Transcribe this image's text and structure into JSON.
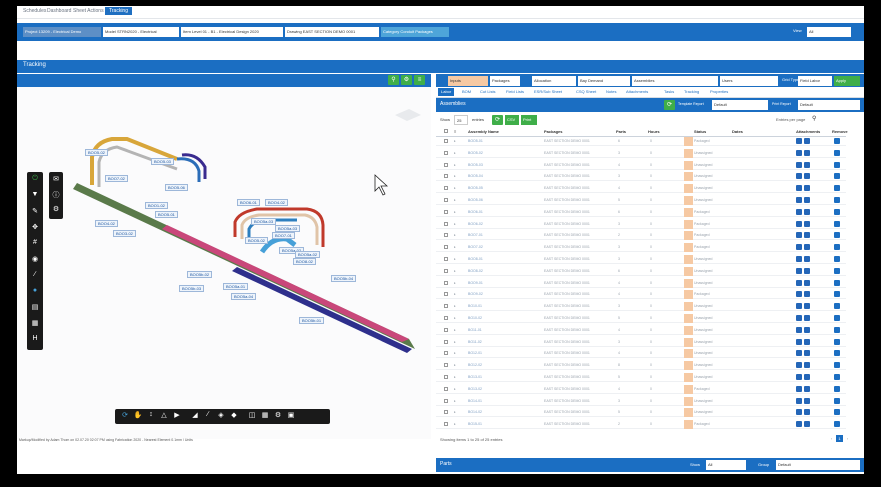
{
  "top_nav": {
    "items": [
      "Schedules",
      "Dashboard",
      "Sheet Actions",
      "Tracking"
    ],
    "active": "Tracking"
  },
  "filters": {
    "project": "Project  13209 - Electrical Demo",
    "model": "Model  STRN2020 - Electrical",
    "item": "Item  Level 01 - B1 - Electrical Design 2020",
    "drawing": "Drawing  EAST SECTION DEMO 0001",
    "category": "Category  Conduit Packages",
    "view_label": "View",
    "view_value": "All"
  },
  "tracking": {
    "title": "Tracking"
  },
  "tags": [
    "BOO5-02",
    "BOO5-03",
    "BOO7-02",
    "BOO5-06",
    "BOO1-02",
    "BOO5-01",
    "BOO4-02",
    "BOO3-02",
    "BOO6-01",
    "BOO4-02",
    "BOO7-01",
    "BOO5-02",
    "BOO5a-02",
    "BOO5a-03",
    "BOO5a-02",
    "BOO5a-03",
    "BOO8-02",
    "BOO5b-02",
    "BOO5b-03",
    "BOO5a-01",
    "BOO5a-04",
    "BOO5b-01",
    "BOO5b-04"
  ],
  "status_line": "Markup/Modified by Adam Thom on 02.07.20 02:07 PM using Fabrication 2020 - Nearest Element 0.1mm / Units",
  "right_header": {
    "label1": "Inputs",
    "sel1": "Packages",
    "sel2": "Allocation",
    "sel3": "Bay Demand",
    "sel4": "Assemblies",
    "sel5": "Users",
    "grid_type_label": "Grid Type",
    "grid_type": "Field Labor",
    "apply": "Apply"
  },
  "tabs": [
    "Labor",
    "BOM",
    "Cut Lists",
    "Field Lists",
    "ESR/Sub Sheet",
    "CSQ Sheet",
    "Notes",
    "Attachments",
    "Tasks",
    "Tracking",
    "Properties"
  ],
  "assemblies": {
    "title": "Assemblies",
    "template_label": "Template Report",
    "template_value": "Default",
    "filter_label": "Print Report",
    "filter_value": "Default",
    "show_label": "Show",
    "show_value": "25",
    "entries_label": "entries",
    "btn_csv": "CSV",
    "btn_print": "Print",
    "search_label": "Entries per page",
    "columns": [
      "Assembly Name",
      "Packages",
      "Parts",
      "Hours",
      "Status",
      "Dates",
      "Attachments",
      "Remove"
    ],
    "rows": [
      {
        "name": "BOO5-01",
        "pkg": "EAST SECTION DEMO 0001",
        "parts": "6",
        "hours": "0",
        "status": "Packaged"
      },
      {
        "name": "BOO5-02",
        "pkg": "EAST SECTION DEMO 0001",
        "parts": "3",
        "hours": "0",
        "status": "Unassigned"
      },
      {
        "name": "BOO5-03",
        "pkg": "EAST SECTION DEMO 0001",
        "parts": "4",
        "hours": "0",
        "status": "Unassigned"
      },
      {
        "name": "BOO5-04",
        "pkg": "EAST SECTION DEMO 0001",
        "parts": "3",
        "hours": "0",
        "status": "Unassigned"
      },
      {
        "name": "BOO5-05",
        "pkg": "EAST SECTION DEMO 0001",
        "parts": "4",
        "hours": "0",
        "status": "Unassigned"
      },
      {
        "name": "BOO5-06",
        "pkg": "EAST SECTION DEMO 0001",
        "parts": "5",
        "hours": "0",
        "status": "Unassigned"
      },
      {
        "name": "BOO6-01",
        "pkg": "EAST SECTION DEMO 0001",
        "parts": "6",
        "hours": "0",
        "status": "Packaged"
      },
      {
        "name": "BOO6-02",
        "pkg": "EAST SECTION DEMO 0001",
        "parts": "3",
        "hours": "0",
        "status": "Packaged"
      },
      {
        "name": "BOO7-01",
        "pkg": "EAST SECTION DEMO 0001",
        "parts": "2",
        "hours": "0",
        "status": "Packaged"
      },
      {
        "name": "BOO7-02",
        "pkg": "EAST SECTION DEMO 0001",
        "parts": "3",
        "hours": "0",
        "status": "Packaged"
      },
      {
        "name": "BOO8-01",
        "pkg": "EAST SECTION DEMO 0001",
        "parts": "3",
        "hours": "0",
        "status": "Unassigned"
      },
      {
        "name": "BOO8-02",
        "pkg": "EAST SECTION DEMO 0001",
        "parts": "6",
        "hours": "0",
        "status": "Unassigned"
      },
      {
        "name": "BOO9-01",
        "pkg": "EAST SECTION DEMO 0001",
        "parts": "4",
        "hours": "0",
        "status": "Unassigned"
      },
      {
        "name": "BOO9-02",
        "pkg": "EAST SECTION DEMO 0001",
        "parts": "4",
        "hours": "0",
        "status": "Packaged"
      },
      {
        "name": "BO10-01",
        "pkg": "EAST SECTION DEMO 0001",
        "parts": "3",
        "hours": "0",
        "status": "Unassigned"
      },
      {
        "name": "BO10-02",
        "pkg": "EAST SECTION DEMO 0001",
        "parts": "5",
        "hours": "0",
        "status": "Unassigned"
      },
      {
        "name": "BO11-01",
        "pkg": "EAST SECTION DEMO 0001",
        "parts": "4",
        "hours": "0",
        "status": "Unassigned"
      },
      {
        "name": "BO11-02",
        "pkg": "EAST SECTION DEMO 0001",
        "parts": "3",
        "hours": "0",
        "status": "Unassigned"
      },
      {
        "name": "BO12-01",
        "pkg": "EAST SECTION DEMO 0001",
        "parts": "4",
        "hours": "0",
        "status": "Unassigned"
      },
      {
        "name": "BO12-02",
        "pkg": "EAST SECTION DEMO 0001",
        "parts": "8",
        "hours": "0",
        "status": "Unassigned"
      },
      {
        "name": "BO13-01",
        "pkg": "EAST SECTION DEMO 0001",
        "parts": "5",
        "hours": "0",
        "status": "Unassigned"
      },
      {
        "name": "BO13-02",
        "pkg": "EAST SECTION DEMO 0001",
        "parts": "4",
        "hours": "0",
        "status": "Packaged"
      },
      {
        "name": "BO14-01",
        "pkg": "EAST SECTION DEMO 0001",
        "parts": "3",
        "hours": "0",
        "status": "Unassigned"
      },
      {
        "name": "BO14-02",
        "pkg": "EAST SECTION DEMO 0001",
        "parts": "5",
        "hours": "0",
        "status": "Unassigned"
      },
      {
        "name": "BO15-01",
        "pkg": "EAST SECTION DEMO 0001",
        "parts": "2",
        "hours": "0",
        "status": "Packaged"
      }
    ],
    "footer": "Showing items 1 to 25 of 25 entries",
    "page": "1"
  },
  "parts": {
    "title": "Parts",
    "show_label": "Show",
    "show_value": "All",
    "filter_label": "Group",
    "filter_value": "Default"
  },
  "colors": {
    "primary": "#1b6ec2",
    "green": "#3fae49",
    "orange": "#f6c9a3"
  }
}
